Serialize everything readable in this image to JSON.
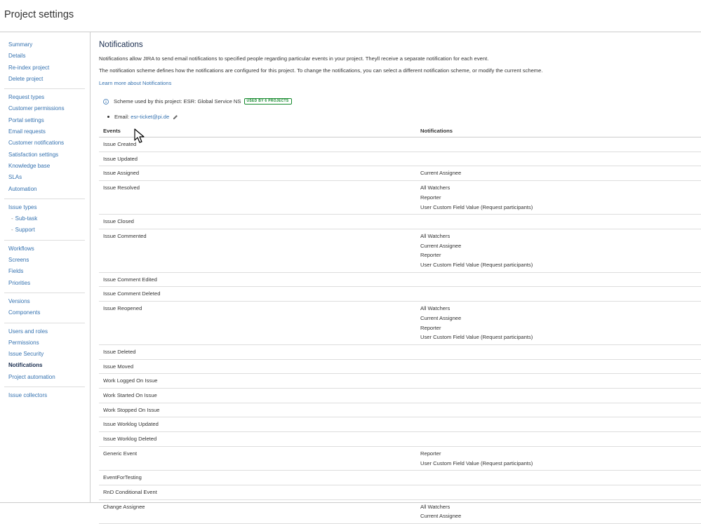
{
  "page": {
    "title": "Project settings"
  },
  "sidebar": {
    "groups": [
      {
        "items": [
          {
            "label": "Summary"
          },
          {
            "label": "Details"
          },
          {
            "label": "Re-index project"
          },
          {
            "label": "Delete project"
          }
        ]
      },
      {
        "items": [
          {
            "label": "Request types"
          },
          {
            "label": "Customer permissions"
          },
          {
            "label": "Portal settings"
          },
          {
            "label": "Email requests"
          },
          {
            "label": "Customer notifications"
          },
          {
            "label": "Satisfaction settings"
          },
          {
            "label": "Knowledge base"
          },
          {
            "label": "SLAs"
          },
          {
            "label": "Automation"
          }
        ]
      },
      {
        "items": [
          {
            "label": "Issue types"
          },
          {
            "label": "Sub-task",
            "sub": true
          },
          {
            "label": "Support",
            "sub": true
          }
        ]
      },
      {
        "items": [
          {
            "label": "Workflows"
          },
          {
            "label": "Screens"
          },
          {
            "label": "Fields"
          },
          {
            "label": "Priorities"
          }
        ]
      },
      {
        "items": [
          {
            "label": "Versions"
          },
          {
            "label": "Components"
          }
        ]
      },
      {
        "items": [
          {
            "label": "Users and roles"
          },
          {
            "label": "Permissions"
          },
          {
            "label": "Issue Security"
          },
          {
            "label": "Notifications",
            "active": true
          },
          {
            "label": "Project automation"
          }
        ]
      },
      {
        "items": [
          {
            "label": "Issue collectors"
          }
        ]
      }
    ]
  },
  "main": {
    "title": "Notifications",
    "description1": "Notifications allow JIRA to send email notifications to specified people regarding particular events in your project. Theyll receive a separate notification for each event.",
    "description2": "The notification scheme defines how the notifications are configured for this project. To change the notifications, you can select a different notification scheme, or modify the current scheme.",
    "learn_more": "Learn more about Notifications",
    "scheme_prefix": "Scheme used by this project: ESR: Global Service NS",
    "scheme_badge": "USED BY 6 PROJECTS",
    "email_prefix": "Email:",
    "email_value": "esr-ticket@pi.de",
    "icons": {
      "info": "info-icon",
      "edit": "pencil-icon",
      "cursor": "mouse-pointer-icon"
    }
  },
  "table": {
    "headers": {
      "events": "Events",
      "notifications": "Notifications"
    },
    "rows": [
      {
        "event": "Issue Created",
        "notifications": []
      },
      {
        "event": "Issue Updated",
        "notifications": []
      },
      {
        "event": "Issue Assigned",
        "notifications": [
          "Current Assignee"
        ]
      },
      {
        "event": "Issue Resolved",
        "notifications": [
          "All Watchers",
          "Reporter",
          "User Custom Field Value (Request participants)"
        ]
      },
      {
        "event": "Issue Closed",
        "notifications": []
      },
      {
        "event": "Issue Commented",
        "notifications": [
          "All Watchers",
          "Current Assignee",
          "Reporter",
          "User Custom Field Value (Request participants)"
        ]
      },
      {
        "event": "Issue Comment Edited",
        "notifications": []
      },
      {
        "event": "Issue Comment Deleted",
        "notifications": []
      },
      {
        "event": "Issue Reopened",
        "notifications": [
          "All Watchers",
          "Current Assignee",
          "Reporter",
          "User Custom Field Value (Request participants)"
        ]
      },
      {
        "event": "Issue Deleted",
        "notifications": []
      },
      {
        "event": "Issue Moved",
        "notifications": []
      },
      {
        "event": "Work Logged On Issue",
        "notifications": []
      },
      {
        "event": "Work Started On Issue",
        "notifications": []
      },
      {
        "event": "Work Stopped On Issue",
        "notifications": []
      },
      {
        "event": "Issue Worklog Updated",
        "notifications": []
      },
      {
        "event": "Issue Worklog Deleted",
        "notifications": []
      },
      {
        "event": "Generic Event",
        "notifications": [
          "Reporter",
          "User Custom Field Value (Request participants)"
        ]
      },
      {
        "event": "EventForTesting",
        "notifications": []
      },
      {
        "event": "RnD Conditional Event",
        "notifications": []
      },
      {
        "event": "Change Assignee",
        "notifications": [
          "All Watchers",
          "Current Assignee"
        ]
      }
    ]
  }
}
